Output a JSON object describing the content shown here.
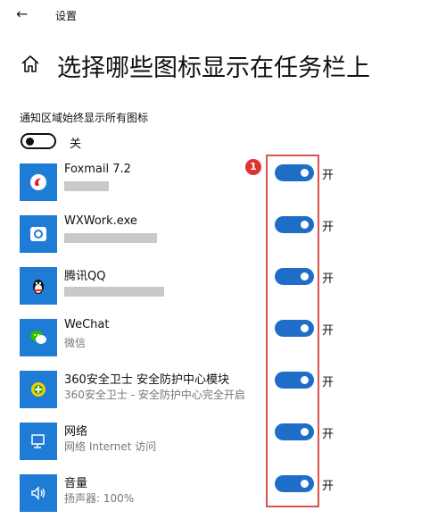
{
  "header": {
    "back_icon": "back-arrow-icon",
    "title": "设置"
  },
  "page": {
    "home_icon": "home-icon",
    "title": "选择哪些图标显示在任务栏上"
  },
  "always_show": {
    "label": "通知区域始终显示所有图标",
    "state": "关"
  },
  "apps": [
    {
      "name": "Foxmail 7.2",
      "subtitle": "",
      "state": "开",
      "icon": "foxmail-icon"
    },
    {
      "name": "WXWork.exe",
      "subtitle": "",
      "state": "开",
      "icon": "wxwork-icon"
    },
    {
      "name": "腾讯QQ",
      "subtitle": "",
      "state": "开",
      "icon": "qq-penguin-icon"
    },
    {
      "name": "WeChat",
      "subtitle": "微信",
      "state": "开",
      "icon": "wechat-icon"
    },
    {
      "name": "360安全卫士 安全防护中心模块",
      "subtitle": "360安全卫士 - 安全防护中心完全开启",
      "state": "开",
      "icon": "360-shield-icon"
    },
    {
      "name": "网络",
      "subtitle": "网络 Internet 访问",
      "state": "开",
      "icon": "network-icon"
    },
    {
      "name": "音量",
      "subtitle": "扬声器: 100%",
      "state": "开",
      "icon": "volume-icon"
    }
  ],
  "annotation": {
    "marker": "1"
  },
  "colors": {
    "accent": "#1e6ec8",
    "icon_bg": "#1e7bd6",
    "highlight": "#d9534f",
    "marker": "#e0322f"
  }
}
